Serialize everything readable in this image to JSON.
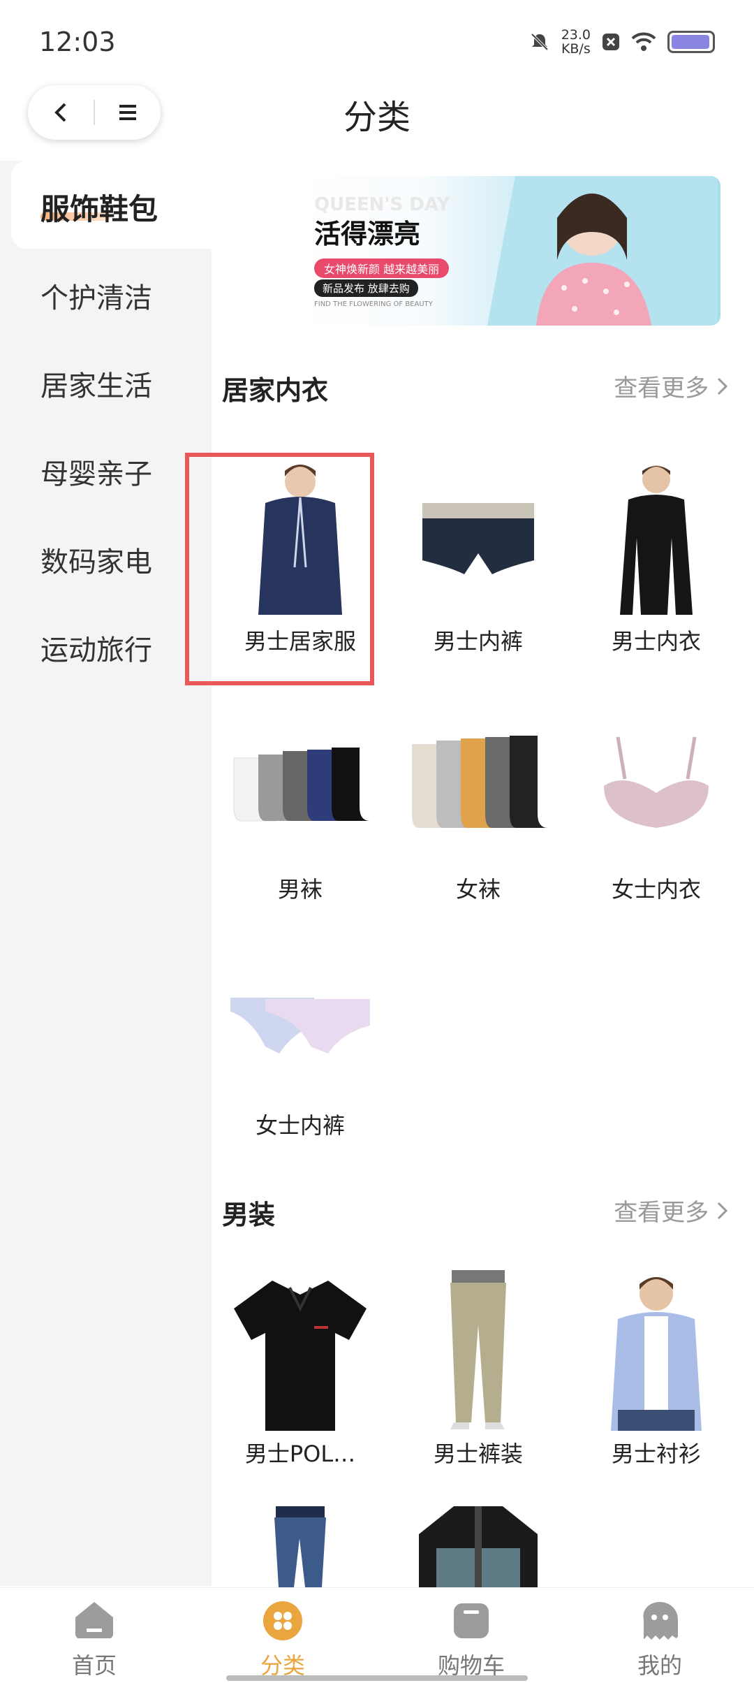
{
  "status_bar": {
    "time": "12:03",
    "net_speed": "23.0",
    "net_unit": "KB/s"
  },
  "header": {
    "title": "分类"
  },
  "sidebar": {
    "items": [
      {
        "label": "服饰鞋包",
        "active": true
      },
      {
        "label": "个护清洁"
      },
      {
        "label": "居家生活"
      },
      {
        "label": "母婴亲子"
      },
      {
        "label": "数码家电"
      },
      {
        "label": "运动旅行"
      }
    ]
  },
  "banner": {
    "title": "活得漂亮",
    "ghost_text": "QUEEN'S DAY",
    "tag1": "女神焕新颜 越来越美丽",
    "tag2": "新品发布 放肆去购",
    "small": "FIND THE FLOWERING OF BEAUTY"
  },
  "sections": [
    {
      "title": "居家内衣",
      "more": "查看更多",
      "items": [
        {
          "label": "男士居家服",
          "icon": "pajamas"
        },
        {
          "label": "男士内裤",
          "icon": "briefs"
        },
        {
          "label": "男士内衣",
          "icon": "long-sleeve-top"
        },
        {
          "label": "男袜",
          "icon": "mens-socks"
        },
        {
          "label": "女袜",
          "icon": "womens-socks"
        },
        {
          "label": "女士内衣",
          "icon": "bra"
        },
        {
          "label": "女士内裤",
          "icon": "panties"
        }
      ]
    },
    {
      "title": "男装",
      "more": "查看更多",
      "items": [
        {
          "label": "男士POL…",
          "icon": "polo-shirt"
        },
        {
          "label": "男士裤装",
          "icon": "trousers"
        },
        {
          "label": "男士衬衫",
          "icon": "shirt"
        },
        {
          "label": "",
          "icon": "jeans"
        },
        {
          "label": "",
          "icon": "down-jacket"
        }
      ]
    }
  ],
  "tabbar": {
    "tabs": [
      {
        "label": "首页",
        "active": false
      },
      {
        "label": "分类",
        "active": true
      },
      {
        "label": "购物车",
        "active": false
      },
      {
        "label": "我的",
        "active": false
      }
    ]
  },
  "colors": {
    "accent": "#e9a53e",
    "highlight": "#e85858",
    "sidebar_bg": "#f4f4f4"
  }
}
